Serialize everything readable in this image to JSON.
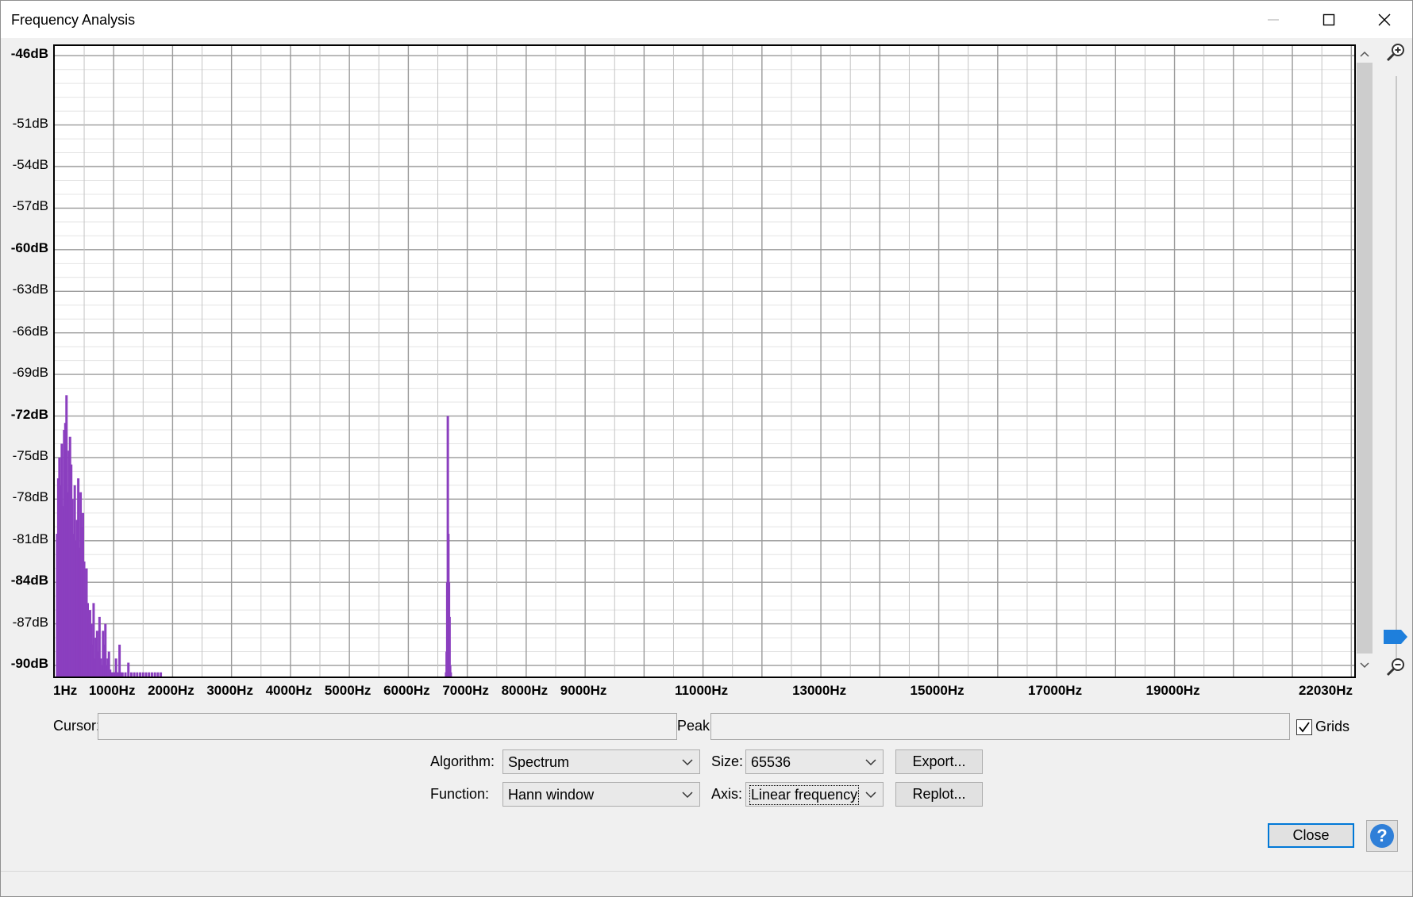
{
  "window": {
    "title": "Frequency Analysis"
  },
  "chart_data": {
    "type": "bar",
    "ylabel": "",
    "xlabel": "",
    "y_ticks": [
      "-46dB",
      "-51dB",
      "-54dB",
      "-57dB",
      "-60dB",
      "-63dB",
      "-66dB",
      "-69dB",
      "-72dB",
      "-75dB",
      "-78dB",
      "-81dB",
      "-84dB",
      "-87dB",
      "-90dB"
    ],
    "y_tick_values": [
      -46,
      -51,
      -54,
      -57,
      -60,
      -63,
      -66,
      -69,
      -72,
      -75,
      -78,
      -81,
      -84,
      -87,
      -90
    ],
    "x_ticks": [
      "1Hz",
      "1000Hz",
      "2000Hz",
      "3000Hz",
      "4000Hz",
      "5000Hz",
      "6000Hz",
      "7000Hz",
      "8000Hz",
      "9000Hz",
      "11000Hz",
      "13000Hz",
      "15000Hz",
      "17000Hz",
      "19000Hz",
      "22030Hz"
    ],
    "x_tick_values": [
      1,
      1000,
      2000,
      3000,
      4000,
      5000,
      6000,
      7000,
      8000,
      9000,
      11000,
      13000,
      15000,
      17000,
      19000,
      22030
    ],
    "xlim": [
      1,
      22050
    ],
    "ylim": [
      -90.8,
      -45.3
    ],
    "grid": true,
    "series": [
      {
        "color": "#8b3fbf",
        "x": [
          40,
          60,
          80,
          100,
          120,
          140,
          160,
          180,
          200,
          220,
          240,
          260,
          280,
          300,
          320,
          340,
          360,
          380,
          400,
          420,
          440,
          460,
          480,
          500,
          520,
          540,
          560,
          580,
          600,
          620,
          640,
          660,
          680,
          700,
          720,
          740,
          760,
          780,
          800,
          820,
          840,
          860,
          880,
          900,
          920,
          940,
          960,
          980,
          1000,
          1020,
          1040,
          1060,
          1080,
          1100,
          1120,
          1150,
          1200,
          1250,
          1300,
          1350,
          1400,
          1450,
          1500,
          1550,
          1600,
          1650,
          1700,
          1750,
          1800,
          6640,
          6650,
          6660,
          6670,
          6680,
          6690,
          6700,
          6710,
          6720
        ],
        "y": [
          -80.5,
          -76.5,
          -75.0,
          -77.0,
          -74.0,
          -78.5,
          -73.0,
          -72.5,
          -70.5,
          -77.5,
          -74.5,
          -73.5,
          -75.5,
          -78.0,
          -80.5,
          -77.0,
          -81.0,
          -79.5,
          -76.5,
          -81.5,
          -77.5,
          -80.0,
          -79.0,
          -82.5,
          -84.5,
          -83.0,
          -85.5,
          -86.5,
          -86.0,
          -87.0,
          -88.5,
          -85.5,
          -89.5,
          -88.0,
          -87.5,
          -89.0,
          -86.5,
          -89.5,
          -90.0,
          -87.5,
          -88.5,
          -87.0,
          -90.0,
          -89.5,
          -89.0,
          -90.3,
          -90.5,
          -90.5,
          -90.5,
          -90.5,
          -89.5,
          -90.5,
          -90.5,
          -88.5,
          -90.5,
          -90.5,
          -90.5,
          -89.8,
          -90.5,
          -90.5,
          -90.5,
          -90.5,
          -90.5,
          -90.5,
          -90.5,
          -90.5,
          -90.5,
          -90.5,
          -90.5,
          -90.5,
          -89.0,
          -84.0,
          -72.0,
          -80.5,
          -84.0,
          -86.5,
          -90.0,
          -90.5
        ]
      }
    ]
  },
  "controls": {
    "cursor_label": "Cursor:",
    "peak_label": "Peak:",
    "grids_label": "Grids",
    "grids_checked": true,
    "algorithm_label": "Algorithm:",
    "algorithm_value": "Spectrum",
    "size_label": "Size:",
    "size_value": "65536",
    "function_label": "Function:",
    "function_value": "Hann window",
    "axis_label": "Axis:",
    "axis_value": "Linear frequency",
    "export_label": "Export...",
    "replot_label": "Replot...",
    "close_label": "Close"
  },
  "icons": {
    "minimize": "minimize-icon",
    "maximize": "maximize-icon",
    "close": "close-icon",
    "zoom_in": "zoom-in-icon",
    "zoom_out": "zoom-out-icon",
    "help": "help-icon"
  }
}
